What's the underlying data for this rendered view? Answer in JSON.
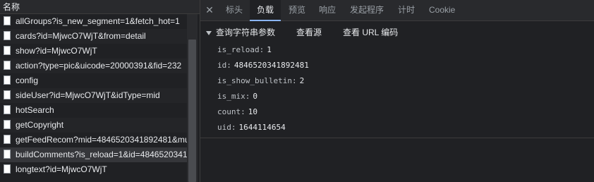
{
  "list": {
    "header": "名称",
    "rows": [
      "allGroups?is_new_segment=1&fetch_hot=1",
      "cards?id=MjwcO7WjT&from=detail",
      "show?id=MjwcO7WjT",
      "action?type=pic&uicode=20000391&fid=232",
      "config",
      "sideUser?id=MjwcO7WjT&idType=mid",
      "hotSearch",
      "getCopyright",
      "getFeedRecom?mid=4846520341892481&mu",
      "buildComments?is_reload=1&id=4846520341",
      "longtext?id=MjwcO7WjT"
    ]
  },
  "tabs": {
    "close": "✕",
    "items": [
      "标头",
      "负载",
      "预览",
      "响应",
      "发起程序",
      "计时",
      "Cookie"
    ]
  },
  "payload": {
    "title": "查询字符串参数",
    "view_source": "查看源",
    "view_url_encoded": "查看 URL 编码",
    "params": [
      {
        "key": "is_reload:",
        "value": "1"
      },
      {
        "key": "id:",
        "value": "4846520341892481"
      },
      {
        "key": "is_show_bulletin:",
        "value": "2"
      },
      {
        "key": "is_mix:",
        "value": "0"
      },
      {
        "key": "count:",
        "value": "10"
      },
      {
        "key": "uid:",
        "value": "1644114654"
      }
    ]
  }
}
